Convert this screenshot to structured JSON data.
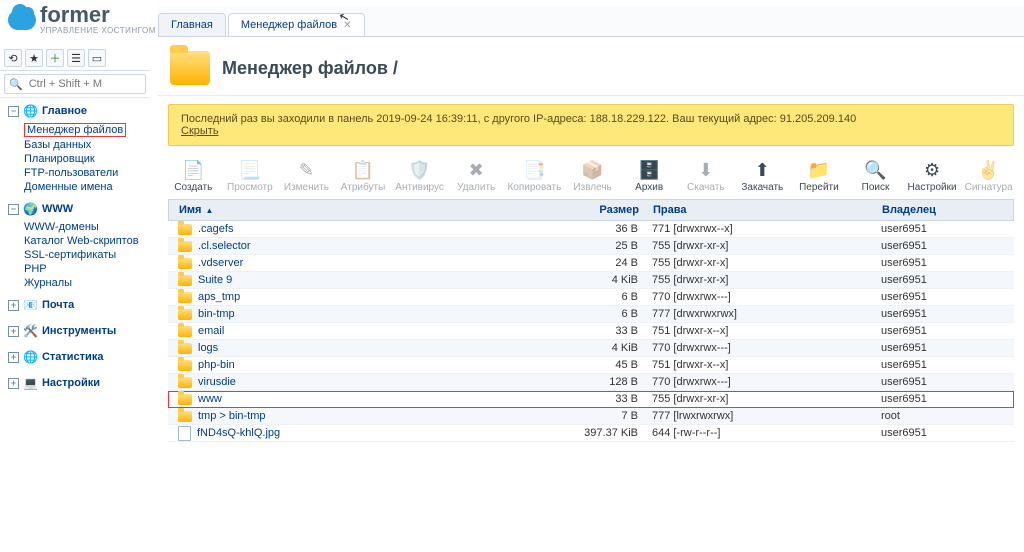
{
  "brand": {
    "name": "former",
    "sub": "УПРАВЛЕНИЕ ХОСТИНГОМ"
  },
  "search": {
    "placeholder": "Ctrl + Shift + M"
  },
  "nav": {
    "sections": [
      {
        "label": "Главное",
        "icon": "🌐",
        "open": true,
        "highlightFirst": true,
        "items": [
          "Менеджер файлов",
          "Базы данных",
          "Планировщик",
          "FTP-пользователи",
          "Доменные имена"
        ]
      },
      {
        "label": "WWW",
        "icon": "🌍",
        "open": true,
        "items": [
          "WWW-домены",
          "Каталог Web-скриптов",
          "SSL-сертификаты",
          "PHP",
          "Журналы"
        ]
      },
      {
        "label": "Почта",
        "icon": "📧",
        "open": false
      },
      {
        "label": "Инструменты",
        "icon": "🛠️",
        "open": false
      },
      {
        "label": "Статистика",
        "icon": "🌐",
        "open": false
      },
      {
        "label": "Настройки",
        "icon": "💻",
        "open": false
      }
    ]
  },
  "tabs": [
    {
      "label": "Главная",
      "active": false,
      "closable": false
    },
    {
      "label": "Менеджер файлов",
      "active": true,
      "closable": true
    }
  ],
  "header": {
    "title": "Менеджер файлов /"
  },
  "notice": {
    "text": "Последний раз вы заходили в панель 2019-09-24 16:39:11, с другого IP-адреса: 188.18.229.122. Ваш текущий адрес: 91.205.209.140",
    "hide": "Скрыть"
  },
  "toolbar": [
    {
      "label": "Создать",
      "icon": "📄",
      "dis": false
    },
    {
      "label": "Просмотр",
      "icon": "📃",
      "dis": true
    },
    {
      "label": "Изменить",
      "icon": "✎",
      "dis": true
    },
    {
      "label": "Атрибуты",
      "icon": "📋",
      "dis": true
    },
    {
      "label": "Антивирус",
      "icon": "🛡️",
      "dis": true
    },
    {
      "label": "Удалить",
      "icon": "✖",
      "dis": true
    },
    {
      "label": "Копировать",
      "icon": "📑",
      "dis": true
    },
    {
      "label": "Извлечь",
      "icon": "📦",
      "dis": true
    },
    {
      "label": "Архив",
      "icon": "🗄️",
      "dis": false
    },
    {
      "label": "Скачать",
      "icon": "⬇",
      "dis": true
    },
    {
      "label": "Закачать",
      "icon": "⬆",
      "dis": false
    },
    {
      "label": "Перейти",
      "icon": "📁",
      "dis": false
    },
    {
      "label": "Поиск",
      "icon": "🔍",
      "dis": false
    },
    {
      "label": "Настройки",
      "icon": "⚙",
      "dis": false
    },
    {
      "label": "Сигнатура",
      "icon": "✌",
      "dis": true
    }
  ],
  "columns": {
    "name": "Имя",
    "size": "Размер",
    "perm": "Права",
    "own": "Владелец"
  },
  "rows": [
    {
      "type": "folder",
      "name": ".cagefs",
      "size": "36 B",
      "perm": "771 [drwxrwx--x]",
      "own": "user6951"
    },
    {
      "type": "folder",
      "name": ".cl.selector",
      "size": "25 B",
      "perm": "755 [drwxr-xr-x]",
      "own": "user6951"
    },
    {
      "type": "folder",
      "name": ".vdserver",
      "size": "24 B",
      "perm": "755 [drwxr-xr-x]",
      "own": "user6951"
    },
    {
      "type": "folder",
      "name": "Suite 9",
      "size": "4 KiB",
      "perm": "755 [drwxr-xr-x]",
      "own": "user6951"
    },
    {
      "type": "folder",
      "name": "aps_tmp",
      "size": "6 B",
      "perm": "770 [drwxrwx---]",
      "own": "user6951"
    },
    {
      "type": "folder",
      "name": "bin-tmp",
      "size": "6 B",
      "perm": "777 [drwxrwxrwx]",
      "own": "user6951"
    },
    {
      "type": "folder",
      "name": "email",
      "size": "33 B",
      "perm": "751 [drwxr-x--x]",
      "own": "user6951"
    },
    {
      "type": "folder",
      "name": "logs",
      "size": "4 KiB",
      "perm": "770 [drwxrwx---]",
      "own": "user6951"
    },
    {
      "type": "folder",
      "name": "php-bin",
      "size": "45 B",
      "perm": "751 [drwxr-x--x]",
      "own": "user6951"
    },
    {
      "type": "folder",
      "name": "virusdie",
      "size": "128 B",
      "perm": "770 [drwxrwx---]",
      "own": "user6951"
    },
    {
      "type": "folder",
      "name": "www",
      "size": "33 B",
      "perm": "755 [drwxr-xr-x]",
      "own": "user6951",
      "hl": true
    },
    {
      "type": "link",
      "name": "tmp > bin-tmp",
      "size": "7 B",
      "perm": "777 [lrwxrwxrwx]",
      "own": "root"
    },
    {
      "type": "file",
      "name": "fND4sQ-khlQ.jpg",
      "size": "397.37 KiB",
      "perm": "644 [-rw-r--r--]",
      "own": "user6951"
    }
  ]
}
